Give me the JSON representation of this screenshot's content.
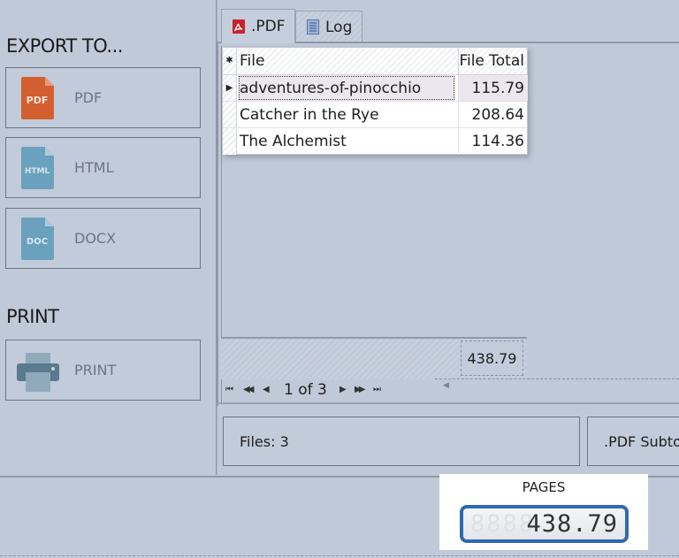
{
  "left_panel": {
    "export_title": "EXPORT TO...",
    "export_buttons": [
      {
        "label": "PDF",
        "icon": "pdf-file-icon",
        "icon_text": "PDF",
        "icon_color": "#d35f30"
      },
      {
        "label": "HTML",
        "icon": "html-file-icon",
        "icon_text": "HTML",
        "icon_color": "#6aa2bd"
      },
      {
        "label": "DOCX",
        "icon": "doc-file-icon",
        "icon_text": "DOC",
        "icon_color": "#6aa2bd"
      }
    ],
    "print_title": "PRINT",
    "print_button": {
      "label": "PRINT",
      "icon": "printer-icon"
    }
  },
  "tabs": [
    {
      "label": ".PDF",
      "icon": "pdf-icon",
      "active": true
    },
    {
      "label": "Log",
      "icon": "log-document-icon",
      "active": false
    }
  ],
  "grid": {
    "columns": [
      "File",
      "File Total"
    ],
    "rows": [
      {
        "file": "adventures-of-pinocchio",
        "total": "115.79",
        "selected": true
      },
      {
        "file": "Catcher in the Rye",
        "total": "208.64",
        "selected": false
      },
      {
        "file": "The Alchemist",
        "total": "114.36",
        "selected": false
      }
    ],
    "summary_total": "438.79"
  },
  "pager": {
    "page_info": "1 of 3",
    "first": "⏮",
    "prev_page": "◀◀",
    "prev": "◀",
    "next": "▶",
    "next_page": "▶▶",
    "last": "⏭"
  },
  "status": {
    "files": "Files: 3",
    "subtotal": ".PDF Subtotal"
  },
  "pages_widget": {
    "label": "PAGES",
    "ghost": "8888",
    "value": "438.79"
  }
}
